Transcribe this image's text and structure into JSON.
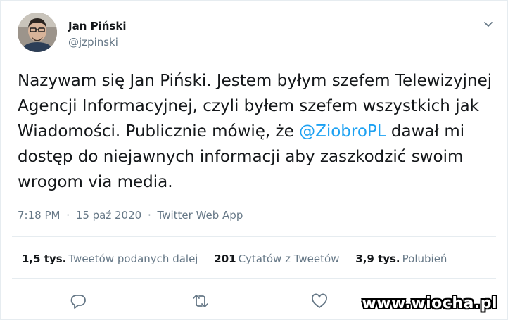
{
  "author": {
    "name": "Jan Piński",
    "handle": "@jzpinski"
  },
  "tweet": {
    "text_before_mention": "Nazywam się Jan Piński. Jestem byłym szefem Telewizyjnej Agencji Informacyjnej, czyli byłem szefem wszystkich jak Wiadomości. Publicznie mówię, że ",
    "mention": "@ZiobroPL",
    "text_after_mention": " dawał mi dostęp do niejawnych informacji aby zaszkodzić swoim wrogom via media."
  },
  "meta": {
    "time": "7:18 PM",
    "separator1": "·",
    "date": "15 paź 2020",
    "separator2": "·",
    "source": "Twitter Web App"
  },
  "stats": {
    "retweets": {
      "count": "1,5 tys.",
      "label": "Tweetów podanych dalej"
    },
    "quotes": {
      "count": "201",
      "label": "Cytatów z Tweetów"
    },
    "likes": {
      "count": "3,9 tys.",
      "label": "Polubień"
    }
  },
  "icons": {
    "menu": "chevron-down-icon",
    "reply": "reply-icon",
    "retweet": "retweet-icon",
    "like": "heart-icon"
  },
  "colors": {
    "link": "#1da1f2",
    "secondary_text": "#657786",
    "primary_text": "#14171a"
  },
  "watermark": "www.wiocha.pl"
}
